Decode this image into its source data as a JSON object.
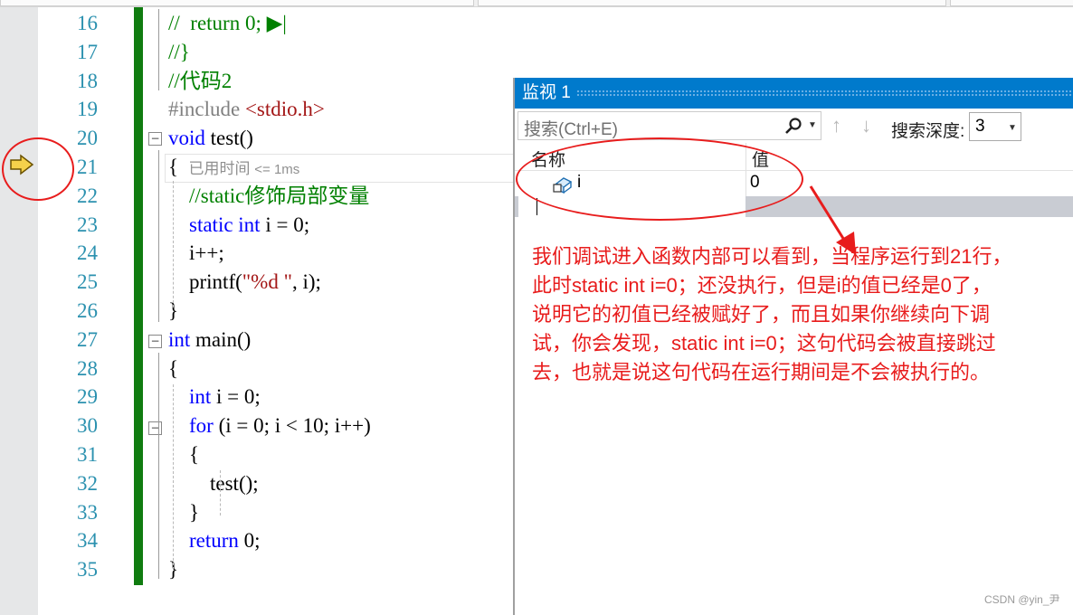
{
  "editor": {
    "lines": [
      {
        "num": "16",
        "html": "<span class=\"cm\">//  return 0; ▶|</span>"
      },
      {
        "num": "17",
        "html": "<span class=\"cm\">//}</span>"
      },
      {
        "num": "18",
        "html": "<span class=\"cm\">//代码2</span>"
      },
      {
        "num": "19",
        "html": "<span class=\"pp\">#include </span><span class=\"inc\">&lt;stdio.h&gt;</span>"
      },
      {
        "num": "20",
        "html": "<span class=\"kw\">void</span> test()"
      },
      {
        "num": "21",
        "html": "{  <span class=\"elapsed\">已用时间 <small>&lt;= 1ms</small></span>"
      },
      {
        "num": "22",
        "html": "    <span class=\"cm\">//static修饰局部变量</span>"
      },
      {
        "num": "23",
        "html": "    <span class=\"kw\">static</span> <span class=\"kw\">int</span> i = 0;"
      },
      {
        "num": "24",
        "html": "    i++;"
      },
      {
        "num": "25",
        "html": "    printf(<span class=\"str\">\"%d \"</span>, i);"
      },
      {
        "num": "26",
        "html": "}"
      },
      {
        "num": "27",
        "html": "<span class=\"kw\">int</span> main()"
      },
      {
        "num": "28",
        "html": "{"
      },
      {
        "num": "29",
        "html": "    <span class=\"kw\">int</span> i = 0;"
      },
      {
        "num": "30",
        "html": "    <span class=\"kw\">for</span> (i = 0; i &lt; 10; i++)"
      },
      {
        "num": "31",
        "html": "    {"
      },
      {
        "num": "32",
        "html": "        test();"
      },
      {
        "num": "33",
        "html": "    }"
      },
      {
        "num": "34",
        "html": "    <span class=\"kw\">return</span> 0;"
      },
      {
        "num": "35",
        "html": "}"
      }
    ],
    "current_line": "21"
  },
  "watch": {
    "title": "监视 1",
    "search_placeholder": "搜索(Ctrl+E)",
    "depth_label": "搜索深度:",
    "depth_value": "3",
    "columns": {
      "name": "名称",
      "value": "值"
    },
    "rows": [
      {
        "name": "i",
        "value": "0"
      }
    ]
  },
  "annotation": {
    "lines": [
      "我们调试进入函数内部可以看到，当程序运行到21行，",
      "此时static int i=0；还没执行，但是i的值已经是0了，",
      "说明它的初值已经被赋好了，而且如果你继续向下调",
      "试，你会发现，static int i=0；这句代码会被直接跳过",
      "去，也就是说这句代码在运行期间是不会被执行的。"
    ],
    "color": "#e81c1c"
  },
  "watermark": "CSDN @yin_尹"
}
